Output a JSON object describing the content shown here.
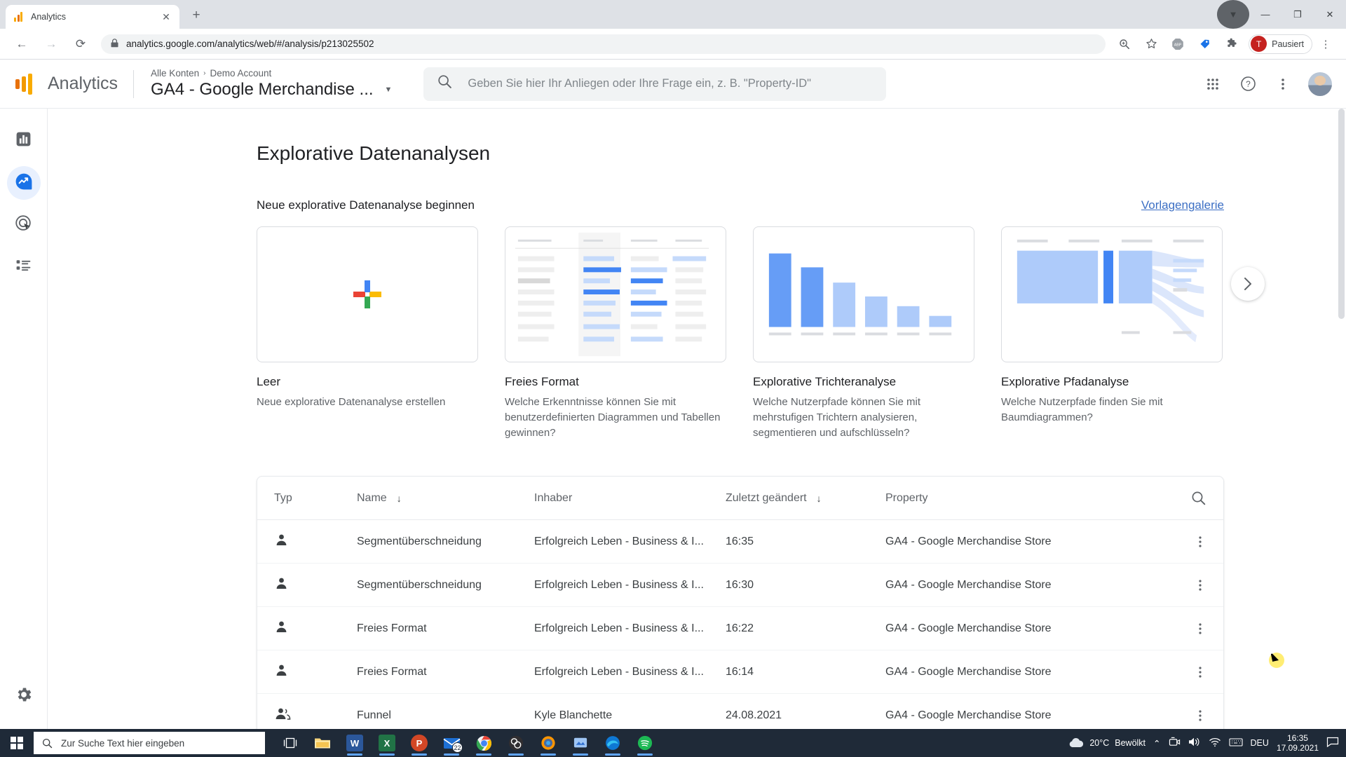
{
  "browser": {
    "tab": {
      "title": "Analytics",
      "favicon": "analytics-favicon",
      "close": "✕"
    },
    "new_tab": "+",
    "window_controls": {
      "minimize": "—",
      "maximize": "❐",
      "close": "✕"
    },
    "nav": {
      "back": "←",
      "forward": "→",
      "reload": "⟳"
    },
    "omnibox": {
      "lock": "🔒",
      "url": "analytics.google.com/analytics/web/#/analysis/p213025502"
    },
    "toolbar_icons": [
      "zoom-icon",
      "bookmark-star-icon",
      "adblock-icon",
      "tag-icon",
      "extensions-icon"
    ],
    "profile": {
      "initial": "T",
      "label": "Pausiert"
    },
    "menu": "⋮"
  },
  "ga_header": {
    "brand": "Analytics",
    "breadcrumb": {
      "account": "Alle Konten",
      "separator": "›",
      "sub": "Demo Account"
    },
    "property_name": "GA4 - Google Merchandise ...",
    "search_placeholder": "Geben Sie hier Ihr Anliegen oder Ihre Frage ein, z. B. \"Property-ID\"",
    "right_icons": [
      "apps-grid-icon",
      "help-icon",
      "more-vert-icon",
      "avatar"
    ]
  },
  "rail": {
    "items": [
      {
        "name": "reports",
        "icon": "bar-chart-icon",
        "active": false
      },
      {
        "name": "explore",
        "icon": "explore-icon",
        "active": true
      },
      {
        "name": "advertising",
        "icon": "target-icon",
        "active": false
      },
      {
        "name": "configure",
        "icon": "list-icon",
        "active": false
      }
    ],
    "settings": {
      "name": "admin",
      "icon": "gear-icon"
    }
  },
  "page": {
    "title": "Explorative Datenanalysen",
    "section_title": "Neue explorative Datenanalyse beginnen",
    "template_gallery_link": "Vorlagengalerie",
    "carousel_next": "›"
  },
  "cards": [
    {
      "thumb": "blank-plus-thumb",
      "title": "Leer",
      "desc": "Neue explorative Datenanalyse erstellen"
    },
    {
      "thumb": "freeform-table-thumb",
      "title": "Freies Format",
      "desc": "Welche Erkenntnisse können Sie mit benutzerdefinierten Diagrammen und Tabellen gewinnen?"
    },
    {
      "thumb": "funnel-bars-thumb",
      "title": "Explorative Trichteranalyse",
      "desc": "Welche Nutzerpfade können Sie mit mehrstufigen Trichtern analysieren, segmentieren und aufschlüsseln?"
    },
    {
      "thumb": "path-sankey-thumb",
      "title": "Explorative Pfadanalyse",
      "desc": "Welche Nutzerpfade finden Sie mit Baumdiagrammen?"
    }
  ],
  "table": {
    "columns": [
      {
        "label": "Typ",
        "sort": ""
      },
      {
        "label": "Name",
        "sort": "↓"
      },
      {
        "label": "Inhaber",
        "sort": ""
      },
      {
        "label": "Zuletzt geändert",
        "sort": "↓"
      },
      {
        "label": "Property",
        "sort": ""
      }
    ],
    "search_icon": "search-icon",
    "rows": [
      {
        "type_icon": "single-user-icon",
        "name": "Segmentüberschneidung",
        "owner": "Erfolgreich Leben - Business & I...",
        "modified": "16:35",
        "property": "GA4 - Google Merchandise Store",
        "menu": "⋮"
      },
      {
        "type_icon": "single-user-icon",
        "name": "Segmentüberschneidung",
        "owner": "Erfolgreich Leben - Business & I...",
        "modified": "16:30",
        "property": "GA4 - Google Merchandise Store",
        "menu": "⋮"
      },
      {
        "type_icon": "single-user-icon",
        "name": "Freies Format",
        "owner": "Erfolgreich Leben - Business & I...",
        "modified": "16:22",
        "property": "GA4 - Google Merchandise Store",
        "menu": "⋮"
      },
      {
        "type_icon": "single-user-icon",
        "name": "Freies Format",
        "owner": "Erfolgreich Leben - Business & I...",
        "modified": "16:14",
        "property": "GA4 - Google Merchandise Store",
        "menu": "⋮"
      },
      {
        "type_icon": "multi-user-icon",
        "name": "Funnel",
        "owner": "Kyle Blanchette",
        "modified": "24.08.2021",
        "property": "GA4 - Google Merchandise Store",
        "menu": "⋮"
      }
    ]
  },
  "taskbar": {
    "start": "windows-start-icon",
    "search_placeholder": "Zur Suche Text hier eingeben",
    "apps": [
      {
        "name": "task-view",
        "label": "",
        "color": "transparent"
      },
      {
        "name": "file-explorer",
        "label": "",
        "color": "#f5c451"
      },
      {
        "name": "word",
        "label": "W",
        "color": "#2b579a"
      },
      {
        "name": "excel",
        "label": "X",
        "color": "#217346"
      },
      {
        "name": "powerpoint",
        "label": "P",
        "color": "#d24726"
      },
      {
        "name": "mail",
        "label": "",
        "color": "#0f6cbd",
        "badge": "22"
      },
      {
        "name": "chrome",
        "label": "",
        "color": "#4285f4"
      },
      {
        "name": "obs",
        "label": "",
        "color": "#302e31"
      },
      {
        "name": "firefox",
        "label": "",
        "color": "#e66000"
      },
      {
        "name": "snip",
        "label": "",
        "color": "#8ab4f8"
      },
      {
        "name": "edge",
        "label": "",
        "color": "#0e78d4"
      },
      {
        "name": "spotify",
        "label": "",
        "color": "#1db954"
      }
    ],
    "tray": {
      "weather_temp": "20°C",
      "weather_text": "Bewölkt",
      "chevron": "⌃",
      "icons": [
        "camera-icon",
        "volume-icon",
        "wifi-icon",
        "keyboard-icon"
      ],
      "language": "DEU",
      "time": "16:35",
      "date": "17.09.2021",
      "notifications": "notification-icon"
    }
  },
  "colors": {
    "accent_blue": "#1a73e8",
    "link_blue": "#3c6fc4",
    "ga_orange": "#f9ab00",
    "taskbar": "#1f2a38"
  }
}
